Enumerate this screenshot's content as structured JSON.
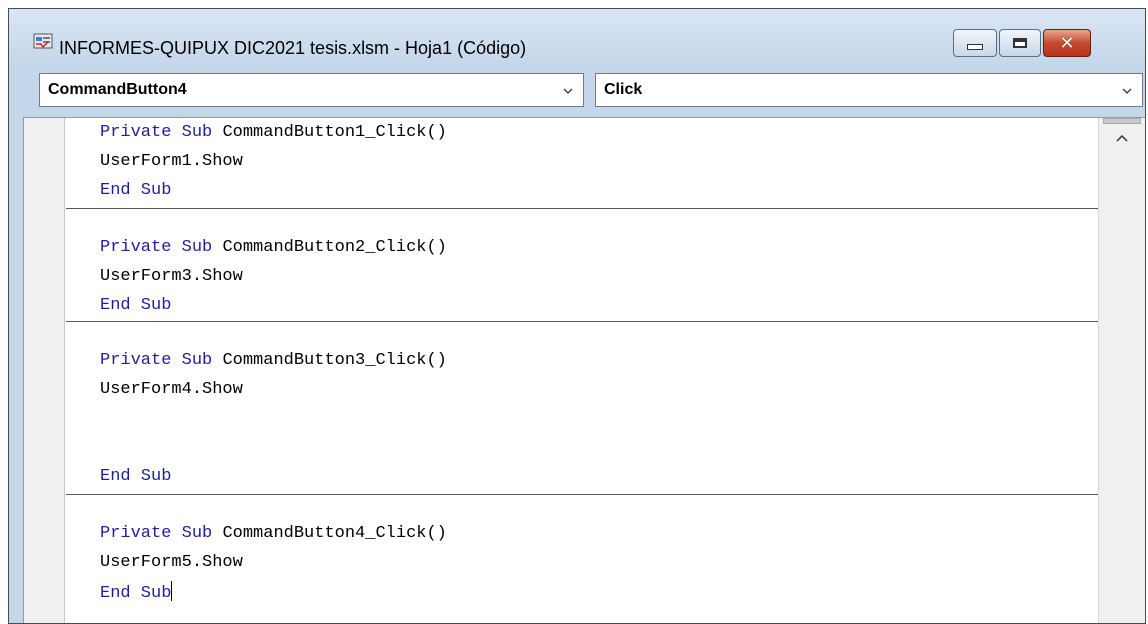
{
  "window": {
    "title": "INFORMES-QUIPUX DIC2021 tesis.xlsm - Hoja1 (Código)",
    "icon": "vba-module-icon",
    "controls": [
      "minimize-icon",
      "maximize-icon",
      "close-icon"
    ]
  },
  "object_combo": {
    "value": "CommandButton4"
  },
  "procedure_combo": {
    "value": "Click"
  },
  "code": {
    "procedures": [
      {
        "sub_line": "Sub CommandButton1_Click()",
        "body": "UserForm1.Show",
        "end": "End Sub"
      },
      {
        "sub_line": "Sub CommandButton2_Click()",
        "body": "UserForm3.Show",
        "end": "End Sub"
      },
      {
        "sub_line": "Sub CommandButton3_Click()",
        "body": "UserForm4.Show",
        "end": "End Sub"
      },
      {
        "sub_line": "Sub CommandButton4_Click()",
        "body": "UserForm5.Show",
        "end": "End Sub"
      }
    ],
    "keyword_private": "Private",
    "keyword_color": "#1f1f9e"
  }
}
